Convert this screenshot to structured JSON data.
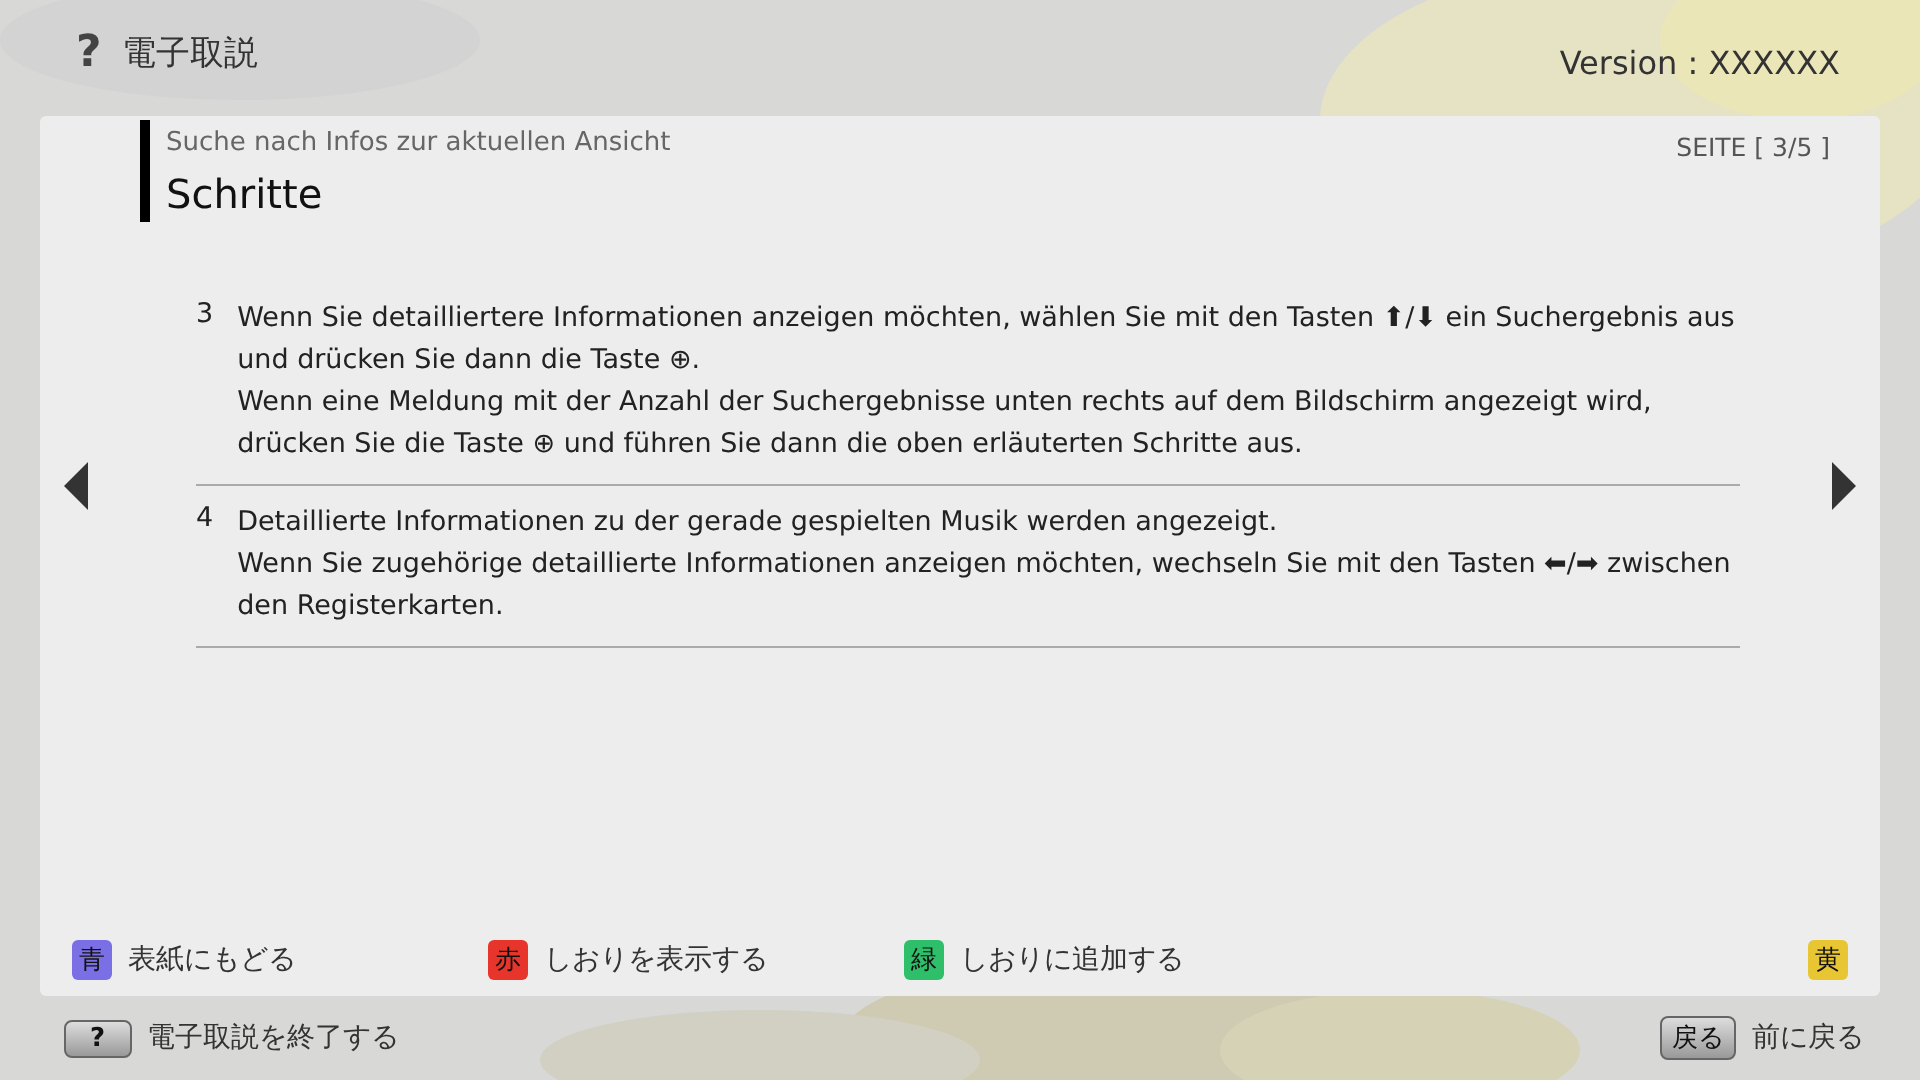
{
  "header": {
    "icon": "?",
    "title": "電子取説",
    "version": "Version : XXXXXX"
  },
  "card": {
    "breadcrumb": "Suche nach Infos zur aktuellen Ansicht",
    "page": "SEITE [ 3/5 ]",
    "heading": "Schritte",
    "steps": [
      {
        "number": "3",
        "lines": [
          "Wenn Sie detailliertere Informationen anzeigen möchten, wählen Sie mit den Tasten ⬆/⬇ ein Suchergebnis aus und drücken Sie dann die Taste ⊕.",
          "Wenn eine Meldung mit der Anzahl der Suchergebnisse unten rechts auf dem Bildschirm angezeigt wird, drücken Sie die Taste ⊕ und führen Sie dann die oben erläuterten Schritte aus."
        ]
      },
      {
        "number": "4",
        "lines": [
          "Detaillierte Informationen zu der gerade gespielten Musik werden angezeigt.",
          "Wenn Sie zugehörige detaillierte Informationen anzeigen möchten, wechseln Sie mit den Tasten ⬅/➡ zwischen den Registerkarten."
        ]
      }
    ],
    "color_keys": [
      {
        "key": "青",
        "label": "表紙にもどる",
        "color": "#7b6fe6"
      },
      {
        "key": "赤",
        "label": "しおりを表示する",
        "color": "#e8352c"
      },
      {
        "key": "緑",
        "label": "しおりに追加する",
        "color": "#2fbf6a"
      },
      {
        "key": "黄",
        "color": "#e8c533"
      }
    ]
  },
  "footer": {
    "exit_key": "?",
    "exit_label": "電子取説を終了する",
    "back_key": "戻る",
    "back_label": "前に戻る"
  }
}
